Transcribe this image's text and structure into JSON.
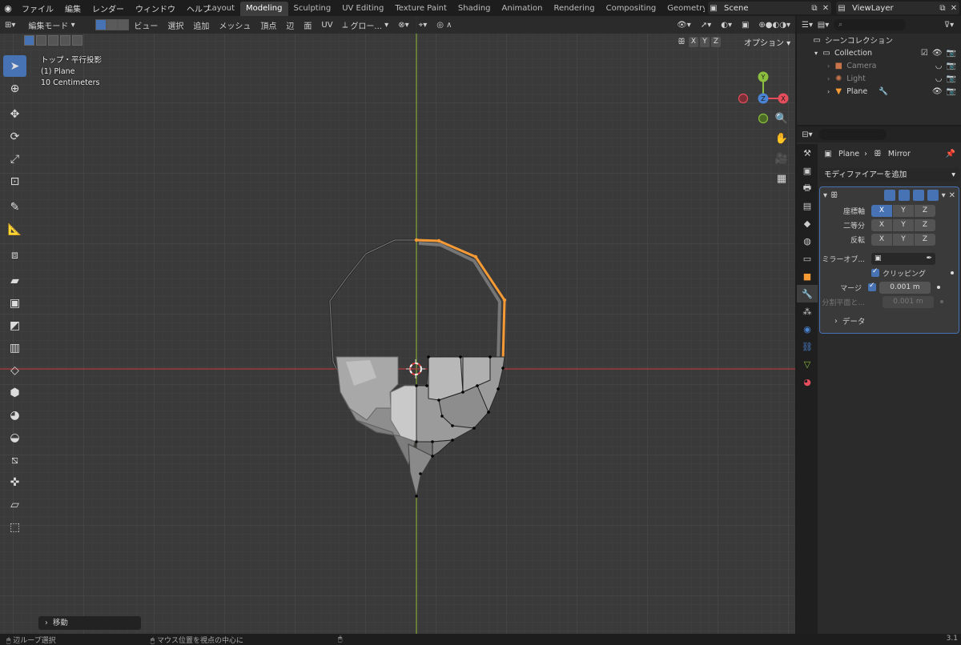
{
  "topbar": {
    "menus": [
      "ファイル",
      "編集",
      "レンダー",
      "ウィンドウ",
      "ヘルプ"
    ],
    "tabs": [
      {
        "label": "Layout",
        "active": false
      },
      {
        "label": "Modeling",
        "active": true
      },
      {
        "label": "Sculpting",
        "active": false
      },
      {
        "label": "UV Editing",
        "active": false
      },
      {
        "label": "Texture Paint",
        "active": false
      },
      {
        "label": "Shading",
        "active": false
      },
      {
        "label": "Animation",
        "active": false
      },
      {
        "label": "Rendering",
        "active": false
      },
      {
        "label": "Compositing",
        "active": false
      },
      {
        "label": "Geometry Nodes",
        "active": false
      },
      {
        "label": "Scriptin",
        "active": false
      }
    ],
    "scene": "Scene",
    "view_layer": "ViewLayer"
  },
  "viewport": {
    "mode": "編集モード",
    "menus": [
      "ビュー",
      "選択",
      "追加",
      "メッシュ",
      "頂点",
      "辺",
      "面",
      "UV"
    ],
    "transform_orientation": "グロー...",
    "axis_buttons": [
      "X",
      "Y",
      "Z"
    ],
    "options_label": "オプション",
    "info": {
      "view_name": "トップ・平行投影",
      "object": "(1) Plane",
      "scale": "10 Centimeters"
    },
    "last_operator": "移動",
    "gizmo": {
      "x_color": "#e44d5b",
      "y_color": "#8bbe3e",
      "z_color": "#4a83d1"
    }
  },
  "statusbar": {
    "items": [
      "辺ループ選択",
      "マウス位置を視点の中心に"
    ],
    "version": "3.1"
  },
  "outliner": {
    "title": "シーンコレクション",
    "items": [
      {
        "label": "Collection",
        "icon": "collection-icon",
        "dim": false
      },
      {
        "label": "Camera",
        "icon": "camera-icon",
        "dim": true
      },
      {
        "label": "Light",
        "icon": "light-icon",
        "dim": true
      },
      {
        "label": "Plane",
        "icon": "mesh-icon",
        "dim": false
      }
    ]
  },
  "properties": {
    "breadcrumb": {
      "object": "Plane",
      "modifier": "Mirror"
    },
    "add_modifier": "モディファイアーを追加",
    "mirror": {
      "axis_label": "座標軸",
      "bisect_label": "二等分",
      "flip_label": "反転",
      "axis_active": [
        "X"
      ],
      "mirror_object_label": "ミラーオブ...",
      "clipping_label": "クリッピング",
      "merge_label": "マージ",
      "merge_value": "0.001 m",
      "bisect_distance_label": "分割平面と...",
      "bisect_distance_value": "0.001 m",
      "data_label": "データ"
    }
  },
  "colors": {
    "accent": "#4772b3",
    "selected_edge": "#f59a35",
    "x_axis_line": "#b03a3a",
    "y_axis_line": "#7fa63b"
  }
}
